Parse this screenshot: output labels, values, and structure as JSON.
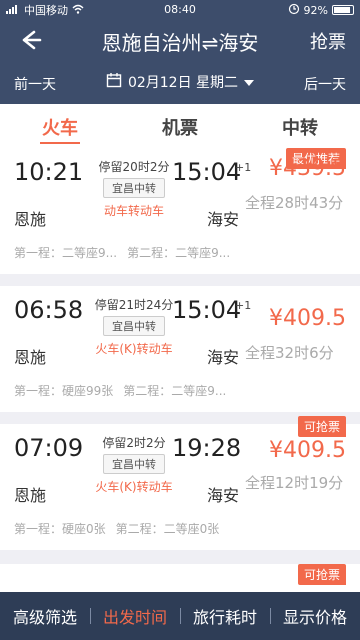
{
  "status": {
    "carrier": "中国移动",
    "time": "08:40",
    "battery": "92%"
  },
  "header": {
    "title": "恩施自治州⇌海安",
    "grab": "抢票",
    "prev_day": "前一天",
    "date": "02月12日 星期二",
    "next_day": "后一天"
  },
  "tabs": [
    {
      "label": "火车"
    },
    {
      "label": "机票"
    },
    {
      "label": "中转"
    }
  ],
  "cards": [
    {
      "dep_time": "10:21",
      "arr_time": "15:04",
      "plus": "+1",
      "stay": "停留20时2分",
      "via": "宜昌中转",
      "mode": "动车转动车",
      "dep_station": "恩施",
      "arr_station": "海安",
      "duration": "全程28时43分",
      "price": "¥439.5",
      "badge": "最优推荐",
      "seat1": "第一程：二等座9...",
      "seat2": "第二程：二等座9..."
    },
    {
      "dep_time": "06:58",
      "arr_time": "15:04",
      "plus": "+1",
      "stay": "停留21时24分",
      "via": "宜昌中转",
      "mode": "火车(K)转动车",
      "dep_station": "恩施",
      "arr_station": "海安",
      "duration": "全程32时6分",
      "price": "¥409.5",
      "badge": "",
      "seat1": "第一程：硬座99张",
      "seat2": "第二程：二等座9..."
    },
    {
      "dep_time": "07:09",
      "arr_time": "19:28",
      "plus": "",
      "stay": "停留2时2分",
      "via": "宜昌中转",
      "mode": "火车(K)转动车",
      "dep_station": "恩施",
      "arr_station": "海安",
      "duration": "全程12时19分",
      "price": "¥409.5",
      "badge": "可抢票",
      "seat1": "第一程：硬座0张",
      "seat2": "第二程：二等座0张"
    }
  ],
  "partial_badge": "可抢票",
  "bottom_bar": [
    {
      "label": "高级筛选"
    },
    {
      "label": "出发时间"
    },
    {
      "label": "旅行耗时"
    },
    {
      "label": "显示价格"
    }
  ],
  "colors": {
    "header": "#3d4d6b",
    "accent": "#f2694b",
    "bottom": "#2e3d56"
  }
}
